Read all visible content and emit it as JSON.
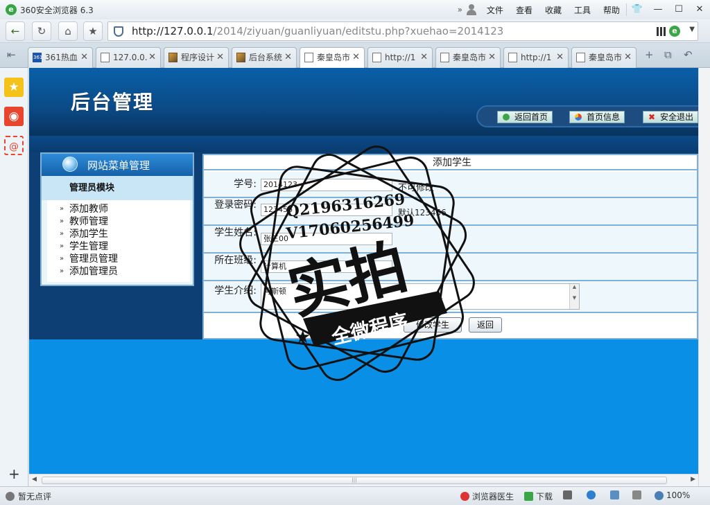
{
  "browser": {
    "title": "360安全浏览器 6.3",
    "menu": [
      "文件",
      "查看",
      "收藏",
      "工具",
      "帮助"
    ],
    "url_host": "http://127.0.0.1",
    "url_path": "/2014/ziyuan/guanliyuan/editstu.php?xuehao=2014123",
    "tabs": [
      {
        "label": "361热血",
        "icon": "site-icon"
      },
      {
        "label": "127.0.0.",
        "icon": "page-icon"
      },
      {
        "label": "程序设计",
        "icon": "image-icon"
      },
      {
        "label": "后台系统",
        "icon": "image-icon"
      },
      {
        "label": "秦皇岛市",
        "icon": "page-icon",
        "active": true
      },
      {
        "label": "http://1",
        "icon": "page-icon"
      },
      {
        "label": "秦皇岛市",
        "icon": "page-icon"
      },
      {
        "label": "http://1",
        "icon": "page-icon"
      },
      {
        "label": "秦皇岛市",
        "icon": "page-icon"
      }
    ],
    "status": {
      "rating": "暂无点评",
      "doctor": "浏览器医生",
      "download": "下载",
      "zoom": "100%"
    }
  },
  "header": {
    "title": "后台管理",
    "nav": [
      "返回首页",
      "首页信息",
      "安全退出"
    ]
  },
  "menu": {
    "title": "网站菜单管理",
    "section": "管理员模块",
    "items": [
      "添加教师",
      "教师管理",
      "添加学生",
      "学生管理",
      "管理员管理",
      "添加管理员"
    ]
  },
  "form": {
    "title": "添加学生",
    "student_id_label": "学号:",
    "student_id_value": "2014123",
    "student_id_note": "不可修改",
    "password_label": "登录密码:",
    "password_value": "123456",
    "password_note": "默认123456",
    "name_label": "学生姓名:",
    "name_value": "张三00",
    "class_label": "所在班级:",
    "class_value": "计算机",
    "intro_label": "学生介绍:",
    "intro_value": "阿斯顿",
    "submit_label": "修改学生",
    "back_label": "返回"
  },
  "watermark": {
    "qq": "Q2196316269",
    "wechat": "V17060256499",
    "big": "实拍",
    "ribbon": "全微程序"
  },
  "colors": {
    "banner": "#0b4a86",
    "page_bg": "#0a8fe6",
    "panel_border": "#7fb0d6"
  }
}
